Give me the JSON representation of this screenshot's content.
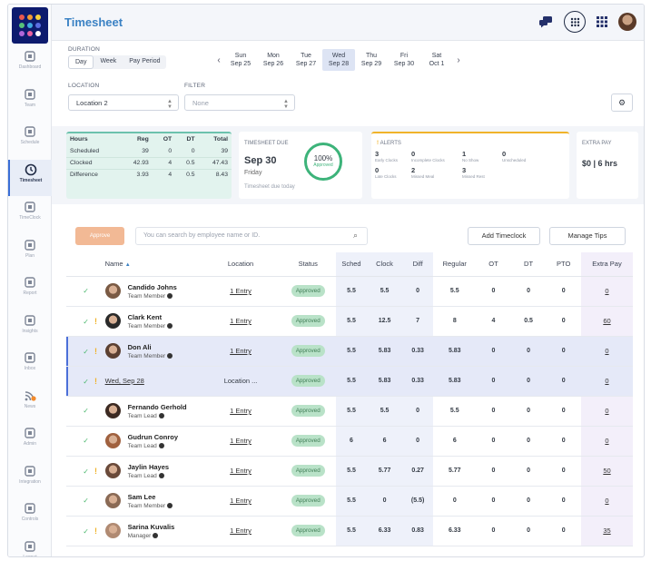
{
  "app": {
    "title": "Timesheet"
  },
  "sidebar": {
    "items": [
      {
        "label": "Dashboard",
        "icon": "dashboard-icon"
      },
      {
        "label": "Team",
        "icon": "team-icon"
      },
      {
        "label": "Schedule",
        "icon": "calendar-icon"
      },
      {
        "label": "Timesheet",
        "icon": "clock-icon"
      },
      {
        "label": "TimeClock",
        "icon": "timeclock-icon"
      },
      {
        "label": "Plan",
        "icon": "plan-icon"
      },
      {
        "label": "Report",
        "icon": "report-icon"
      },
      {
        "label": "Insights",
        "icon": "insights-icon"
      },
      {
        "label": "Inbox",
        "icon": "inbox-icon"
      },
      {
        "label": "News",
        "icon": "news-icon"
      },
      {
        "label": "Admin",
        "icon": "wrench-icon"
      },
      {
        "label": "Integration",
        "icon": "plug-icon"
      },
      {
        "label": "Controls",
        "icon": "gear-icon"
      },
      {
        "label": "Logout",
        "icon": "logout-icon"
      }
    ]
  },
  "controls": {
    "duration_label": "DURATION",
    "duration_options": [
      "Day",
      "Week",
      "Pay Period"
    ],
    "days": [
      {
        "dow": "Sun",
        "date": "Sep 25"
      },
      {
        "dow": "Mon",
        "date": "Sep 26"
      },
      {
        "dow": "Tue",
        "date": "Sep 27"
      },
      {
        "dow": "Wed",
        "date": "Sep 28"
      },
      {
        "dow": "Thu",
        "date": "Sep 29"
      },
      {
        "dow": "Fri",
        "date": "Sep 30"
      },
      {
        "dow": "Sat",
        "date": "Oct 1"
      }
    ],
    "location_label": "LOCATION",
    "location_value": "Location 2",
    "filter_label": "FILTER",
    "filter_value": "None"
  },
  "hours": {
    "headers": [
      "Hours",
      "Reg",
      "OT",
      "DT",
      "Total"
    ],
    "rows": [
      [
        "Scheduled",
        "39",
        "0",
        "0",
        "39"
      ],
      [
        "Clocked",
        "42.93",
        "4",
        "0.5",
        "47.43"
      ],
      [
        "Difference",
        "3.93",
        "4",
        "0.5",
        "8.43"
      ]
    ]
  },
  "due": {
    "title": "TIMESHEET DUE",
    "date": "Sep 30",
    "day": "Friday",
    "note": "Timesheet due today",
    "percent": "100%",
    "percent_label": "Approved"
  },
  "alerts": {
    "title": "ALERTS",
    "items": [
      {
        "count": "3",
        "label": "Early Clocks"
      },
      {
        "count": "0",
        "label": "Incomplete Clocks"
      },
      {
        "count": "1",
        "label": "No Show"
      },
      {
        "count": "0",
        "label": "Unscheduled"
      },
      {
        "count": "0",
        "label": "Late Clocks"
      },
      {
        "count": "2",
        "label": "Missed Meal"
      },
      {
        "count": "3",
        "label": "Missed Rest"
      },
      {
        "count": "",
        "label": ""
      }
    ]
  },
  "extra_pay": {
    "title": "EXTRA PAY",
    "value": "$0 | 6 hrs"
  },
  "toolbar": {
    "approve": "Approve",
    "search_placeholder": "You can search by employee name or ID.",
    "add_timeclock": "Add Timeclock",
    "manage_tips": "Manage Tips"
  },
  "table": {
    "headers": [
      "Name",
      "Location",
      "Status",
      "Sched",
      "Clock",
      "Diff",
      "Regular",
      "OT",
      "DT",
      "PTO",
      "Extra Pay"
    ],
    "rows": [
      {
        "name": "Candido Johns",
        "role": "Team Member",
        "location": "1 Entry",
        "status": "Approved",
        "sched": "5.5",
        "clock": "5.5",
        "diff": "0",
        "regular": "5.5",
        "ot": "0",
        "dt": "0",
        "pto": "0",
        "extra": "0",
        "alert": false,
        "av": "#7a5a44"
      },
      {
        "name": "Clark Kent",
        "role": "Team Member",
        "location": "1 Entry",
        "status": "Approved",
        "sched": "5.5",
        "clock": "12.5",
        "diff": "7",
        "regular": "8",
        "ot": "4",
        "dt": "0.5",
        "pto": "0",
        "extra": "60",
        "alert": true,
        "av": "#2a2a2a"
      },
      {
        "name": "Don Ali",
        "role": "Team Member",
        "location": "1 Entry",
        "status": "Approved",
        "sched": "5.5",
        "clock": "5.83",
        "diff": "0.33",
        "regular": "5.83",
        "ot": "0",
        "dt": "0",
        "pto": "0",
        "extra": "0",
        "alert": true,
        "av": "#5b4032",
        "highlight": true
      },
      {
        "sub": true,
        "date": "Wed, Sep 28",
        "location": "Location ...",
        "status": "Approved",
        "sched": "5.5",
        "clock": "5.83",
        "diff": "0.33",
        "regular": "5.83",
        "ot": "0",
        "dt": "0",
        "pto": "0",
        "extra": "0",
        "alert": true
      },
      {
        "name": "Fernando Gerhold",
        "role": "Team Lead",
        "location": "1 Entry",
        "status": "Approved",
        "sched": "5.5",
        "clock": "5.5",
        "diff": "0",
        "regular": "5.5",
        "ot": "0",
        "dt": "0",
        "pto": "0",
        "extra": "0",
        "alert": false,
        "av": "#3c2a22"
      },
      {
        "name": "Gudrun Conroy",
        "role": "Team Lead",
        "location": "1 Entry",
        "status": "Approved",
        "sched": "6",
        "clock": "6",
        "diff": "0",
        "regular": "6",
        "ot": "0",
        "dt": "0",
        "pto": "0",
        "extra": "0",
        "alert": false,
        "av": "#a0613f"
      },
      {
        "name": "Jaylin Hayes",
        "role": "Team Lead",
        "location": "1 Entry",
        "status": "Approved",
        "sched": "5.5",
        "clock": "5.77",
        "diff": "0.27",
        "regular": "5.77",
        "ot": "0",
        "dt": "0",
        "pto": "0",
        "extra": "50",
        "alert": true,
        "av": "#6a4a3a"
      },
      {
        "name": "Sam Lee",
        "role": "Team Member",
        "location": "1 Entry",
        "status": "Approved",
        "sched": "5.5",
        "clock": "0",
        "diff": "(5.5)",
        "regular": "0",
        "ot": "0",
        "dt": "0",
        "pto": "0",
        "extra": "0",
        "alert": false,
        "av": "#8a6a55"
      },
      {
        "name": "Sarina Kuvalis",
        "role": "Manager",
        "location": "1 Entry",
        "status": "Approved",
        "sched": "5.5",
        "clock": "6.33",
        "diff": "0.83",
        "regular": "6.33",
        "ot": "0",
        "dt": "0",
        "pto": "0",
        "extra": "35",
        "alert": true,
        "av": "#b08a72"
      }
    ]
  }
}
